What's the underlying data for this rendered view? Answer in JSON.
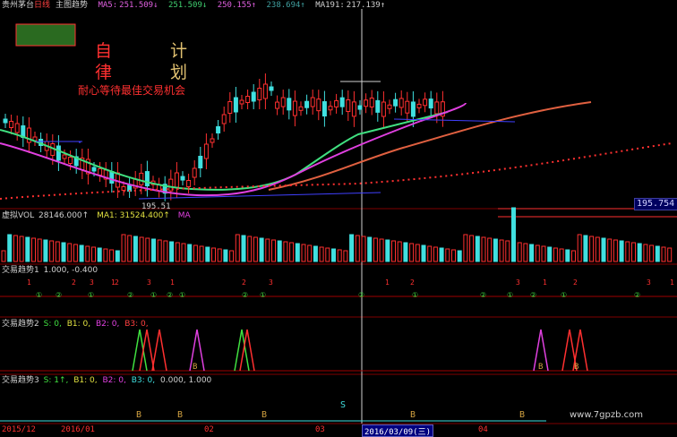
{
  "main_header": {
    "stock_name": "贵州茅台",
    "period": "日线",
    "indicator": "主图趋势",
    "items": [
      {
        "label": "MA5:",
        "value": "251.509↓",
        "color": "#e060e0"
      },
      {
        "label": "",
        "value": "251.509↓",
        "color": "#40d070"
      },
      {
        "label": "",
        "value": "250.155↑",
        "color": "#e060e0"
      },
      {
        "label": "",
        "value": "238.694↑",
        "color": "#40a0a0"
      },
      {
        "label": "MA191:",
        "value": "217.139↑",
        "color": "#d0d0d0"
      }
    ]
  },
  "overlay_text": {
    "char1": "自",
    "char2": "计",
    "char3": "律",
    "char4": "划",
    "slogan": "耐心等待最佳交易机会"
  },
  "price_labels": {
    "low_label": "195.51",
    "axis_label": "195.754"
  },
  "vol_header": {
    "title": "虚拟VOL",
    "value": "28146.000↑",
    "ma1": "MA1: 31524.400↑",
    "ma_label": "MA"
  },
  "panel1_header": {
    "title": "交易趋势1",
    "vals": "1.000, -0.400"
  },
  "panel2_header": {
    "title": "交易趋势2",
    "s": "S: 0,",
    "b1": "B1: 0,",
    "b2": "B2: 0,",
    "b3": "B3: 0,"
  },
  "panel3_header": {
    "title": "交易趋势3",
    "s": "S: 1↑,",
    "b1": "B1: 0,",
    "b2": "B2: 0,",
    "b3": "B3: 0,",
    "vals": "0.000, 1.000"
  },
  "date_axis": {
    "labels": [
      "2015/12",
      "2016/01",
      "02",
      "03",
      "2016/03/09(三)",
      "04"
    ]
  },
  "watermark": "www.7gpzb.com",
  "panel1_markers": [
    "1",
    "2",
    "3",
    "①",
    "②"
  ],
  "panel3_markers": [
    "B",
    "S"
  ],
  "colors": {
    "up": "#ff3030",
    "down": "#40e0e0",
    "ma_pink": "#e040e0",
    "ma_green": "#40e080",
    "ma_orange": "#e06040",
    "panel_line": "#a00000",
    "gold": "#d0a040"
  }
}
